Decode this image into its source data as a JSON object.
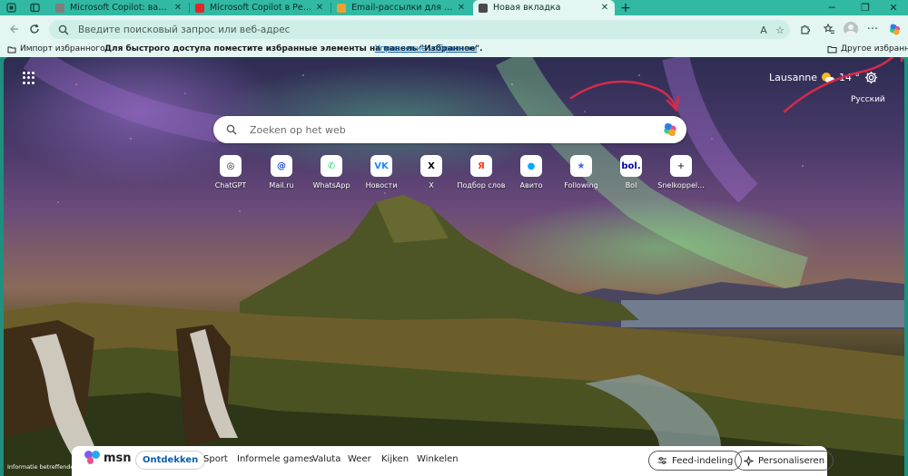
{
  "browser": {
    "tabs": [
      {
        "title": "Microsoft Copilot: ваш ИИ-помощник",
        "favicon_color": "#7d7d7d",
        "active": false
      },
      {
        "title": "Microsoft Copilot в Реальной Работе",
        "favicon_color": "#e02626",
        "active": false
      },
      {
        "title": "Email-рассылки для НКО: как «Добро»",
        "favicon_color": "#f0a030",
        "active": false
      },
      {
        "title": "Новая вкладка",
        "favicon_color": "#4a4a4a",
        "active": true
      }
    ],
    "address_bar": {
      "placeholder": "Введите поисковый запрос или веб-адрес"
    },
    "favorites_bar": {
      "import_label": "Импорт избранного",
      "message": "Для быстрого доступа поместите избранные элементы на панель \"Избранное\".",
      "manage_link": "Управление избранным",
      "other_label": "Другое избранное"
    }
  },
  "newtab": {
    "weather": {
      "city": "Lausanne",
      "temp": "14 °"
    },
    "language": "Русский",
    "search": {
      "placeholder": "Zoeken op het web"
    },
    "quick_links": [
      {
        "label": "ChatGPT",
        "icon": "chatgpt-icon",
        "glyph": "◎",
        "color": "#111111"
      },
      {
        "label": "Mail.ru",
        "icon": "mailru-icon",
        "glyph": "@",
        "color": "#1e4fc4"
      },
      {
        "label": "WhatsApp",
        "icon": "whatsapp-icon",
        "glyph": "✆",
        "color": "#25d366"
      },
      {
        "label": "Новости",
        "icon": "vk-icon",
        "glyph": "VK",
        "color": "#2787f5"
      },
      {
        "label": "X",
        "icon": "x-icon",
        "glyph": "X",
        "color": "#000000"
      },
      {
        "label": "Подбор слов",
        "icon": "yandex-icon",
        "glyph": "Я",
        "color": "#fc3f1d"
      },
      {
        "label": "Авито",
        "icon": "avito-icon",
        "glyph": "●",
        "color": "#00aaff"
      },
      {
        "label": "Following",
        "icon": "following-icon",
        "glyph": "★",
        "color": "#3b6fd8"
      },
      {
        "label": "Bol",
        "icon": "bol-icon",
        "glyph": "bol.",
        "color": "#0000a4"
      },
      {
        "label": "Snelkoppel...",
        "icon": "add-icon",
        "glyph": "+",
        "color": "#444444"
      }
    ],
    "disclaimer": "Informatie betreffende co"
  },
  "msn": {
    "logo_text": "msn",
    "tabs": [
      "Ontdekken",
      "Sport",
      "Informele games",
      "Valuta",
      "Weer",
      "Kijken",
      "Winkelen"
    ],
    "active_tab": "Ontdekken",
    "feed_button": "Feed-indeling",
    "personalize_button": "Personaliseren"
  }
}
